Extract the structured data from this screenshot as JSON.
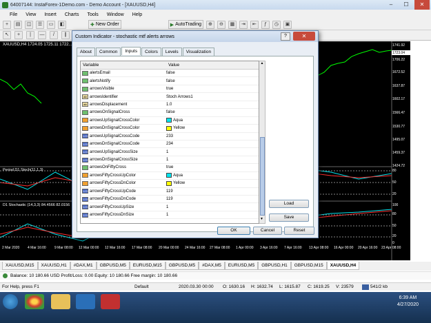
{
  "window": {
    "title": "64007144: InstaForex-1Demo.com - Demo Account - [XAUUSD,H4]",
    "minimize": "–",
    "maximize": "☐",
    "close": "✕"
  },
  "menu": [
    "File",
    "View",
    "Insert",
    "Charts",
    "Tools",
    "Window",
    "Help"
  ],
  "toolbar": {
    "new_order": "New Order",
    "autotrading": "AutoTrading"
  },
  "chart": {
    "title": "XAUUSD,H4  1724.05 1725.11 1722...",
    "prices": [
      "1741.92",
      "1723.04",
      "1706.22",
      "1672.52",
      "1637.87",
      "1602.17",
      "1566.47",
      "1530.77",
      "1495.07",
      "1459.37",
      "1424.72"
    ],
    "sub1_title": "Period D1 Stoch(11,1,3)",
    "sub1_levels": [
      "80",
      "50",
      "20"
    ],
    "sub2_title": "D1 Stochastic (14,3,3) 84.4566 82.0156",
    "sub2_levels": [
      "100",
      "80",
      "50",
      "20",
      "0"
    ],
    "dates": [
      "2 Mar 2020",
      "4 Mar 16:00",
      "9 Mar 08:00",
      "12 Mar 00:00",
      "12 Mar 16:00",
      "17 Mar 08:00",
      "20 Mar 00:00",
      "24 Mar 16:00",
      "27 Mar 08:00",
      "1 Apr 00:00",
      "3 Apr 16:00",
      "7 Apr 16:00",
      "13 Apr 08:00",
      "16 Apr 00:00",
      "20 Apr 16:00",
      "23 Apr 08:00"
    ]
  },
  "dialog": {
    "title": "Custom Indicator - stochastic mtf alerts arrows",
    "help": "?",
    "close": "✕",
    "tabs": [
      "About",
      "Common",
      "Inputs",
      "Colors",
      "Levels",
      "Visualization"
    ],
    "active_tab": "Inputs",
    "col_variable": "Variable",
    "col_value": "Value",
    "rows": [
      {
        "name": "alertsEmail",
        "type": "bool",
        "value": "false"
      },
      {
        "name": "alertsNotify",
        "type": "bool",
        "value": "false"
      },
      {
        "name": "arrowsVisible",
        "type": "bool",
        "value": "true"
      },
      {
        "name": "arrowsIdentifier",
        "type": "str",
        "value": "Stoch Arrows1"
      },
      {
        "name": "arrowsDisplacement",
        "type": "str",
        "value": "1.0"
      },
      {
        "name": "arrowsOnSignalCross",
        "type": "bool",
        "value": "false"
      },
      {
        "name": "arrowsUpSignalCrossColor",
        "type": "color",
        "value": "Aqua",
        "swatch": "#00e5ee"
      },
      {
        "name": "arrowsDnSignalCrossColor",
        "type": "color",
        "value": "Yellow",
        "swatch": "#ffff00"
      },
      {
        "name": "arrowsUpSignalCrossCode",
        "type": "int",
        "value": "233"
      },
      {
        "name": "arrowsDnSignalCrossCode",
        "type": "int",
        "value": "234"
      },
      {
        "name": "arrowsUpSignalCrossSize",
        "type": "int",
        "value": "1"
      },
      {
        "name": "arrowsDnSignalCrossSize",
        "type": "int",
        "value": "1"
      },
      {
        "name": "arrowsOnFiftyCross",
        "type": "bool",
        "value": "true"
      },
      {
        "name": "arrowsFiftyCrossUpColor",
        "type": "color",
        "value": "Aqua",
        "swatch": "#00e5ee"
      },
      {
        "name": "arrowsFiftyCrossDnColor",
        "type": "color",
        "value": "Yellow",
        "swatch": "#ffff00"
      },
      {
        "name": "arrowsFiftyCrossUpCode",
        "type": "int",
        "value": "119"
      },
      {
        "name": "arrowsFiftyCrossDnCode",
        "type": "int",
        "value": "119"
      },
      {
        "name": "arrowsFiftyCrossUpSize",
        "type": "int",
        "value": "1"
      },
      {
        "name": "arrowsFiftyCrossDnSize",
        "type": "int",
        "value": "1"
      }
    ],
    "load": "Load",
    "save": "Save",
    "ok": "OK",
    "cancel": "Cancel",
    "reset": "Reset"
  },
  "chart_tabs": [
    "XAUUSD,M15",
    "XAUUSD,H1",
    "#DAX,M1",
    "GBPUSD,M5",
    "EURUSD,M15",
    "GBPUSD,M5",
    "#DAX,M5",
    "EURUSD,M5",
    "GBPUSD,H1",
    "GBPUSD,M15",
    "XAUUSD,H4"
  ],
  "active_chart_tab": "XAUUSD,H4",
  "balance_line": "Balance: 10 180.66 USD  Profit/Loss: 0.00  Equity: 10 180.66  Free margin: 10 180.66",
  "status": {
    "help": "For Help, press F1",
    "profile": "Default",
    "time": "2020.03.30 00:00",
    "open": "O: 1630.16",
    "high": "H: 1632.74",
    "low": "L: 1615.87",
    "close": "C: 1619.25",
    "volume": "V: 23579",
    "traffic": "541/2 kb"
  },
  "clock": {
    "time": "6:39 AM",
    "date": "4/27/2020"
  }
}
